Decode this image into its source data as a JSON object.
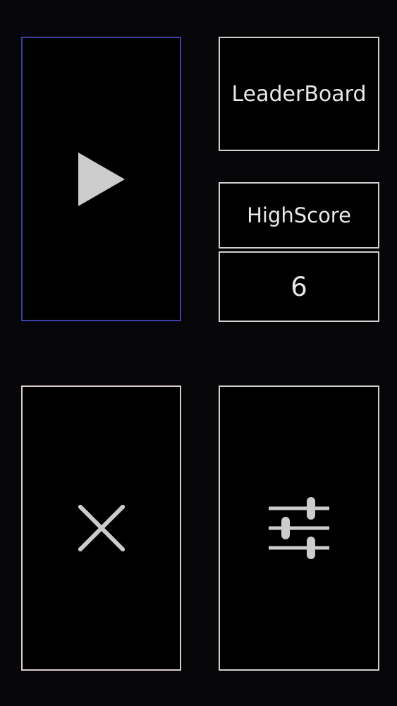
{
  "menu": {
    "play_icon": "play-icon",
    "leaderboard_label": "LeaderBoard",
    "highscore_label": "HighScore",
    "highscore_value": "6",
    "exit_icon": "close-icon",
    "settings_icon": "sliders-icon"
  },
  "colors": {
    "background": "#060507",
    "tile_border": "#cfcfcf",
    "play_border": "#3c3fa6",
    "icon": "#cccccc"
  }
}
